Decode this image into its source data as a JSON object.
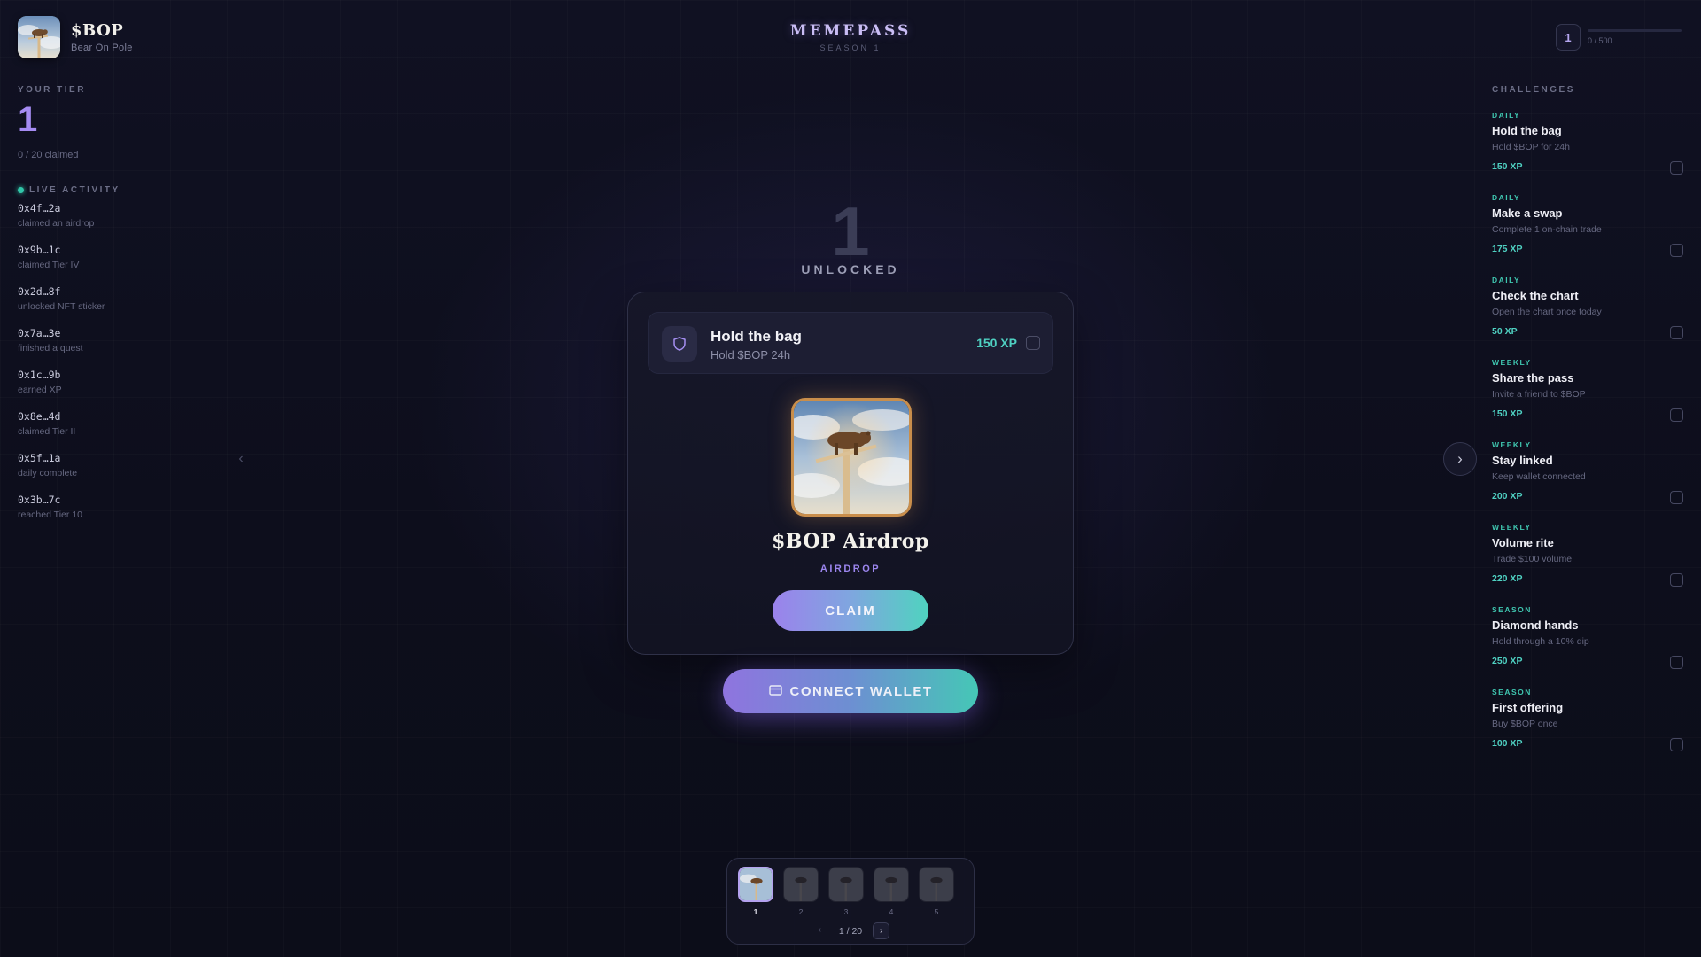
{
  "brand": {
    "name": "$BOP",
    "subtitle": "Bear On Pole",
    "logo_icon": "bear-on-pole-icon"
  },
  "app": {
    "title": "MEMEPASS",
    "season": "SEASON 1"
  },
  "top_tier": {
    "current": "1",
    "progress_text": "0 / 500",
    "progress_fraction": 0
  },
  "left": {
    "tier_label": "YOUR TIER",
    "tier_value": "1",
    "claimed_text": "0 / 20 claimed",
    "live_label": "LIVE ACTIVITY",
    "activity": [
      {
        "address": "0x4f…2a",
        "action": "claimed an airdrop"
      },
      {
        "address": "0x9b…1c",
        "action": "claimed Tier IV"
      },
      {
        "address": "0x2d…8f",
        "action": "unlocked NFT sticker"
      },
      {
        "address": "0x7a…3e",
        "action": "finished a quest"
      },
      {
        "address": "0x1c…9b",
        "action": "earned XP"
      },
      {
        "address": "0x8e…4d",
        "action": "claimed Tier II"
      },
      {
        "address": "0x5f…1a",
        "action": "daily complete"
      },
      {
        "address": "0x3b…7c",
        "action": "reached Tier 10"
      }
    ]
  },
  "center": {
    "tier_number": "1",
    "status": "UNLOCKED",
    "challenge": {
      "title": "Hold the bag",
      "description": "Hold $BOP 24h",
      "xp": "150 XP",
      "icon": "shield-icon"
    },
    "reward": {
      "title": "$BOP Airdrop",
      "type": "AIRDROP"
    },
    "claim_label": "CLAIM",
    "wallet_label": "CONNECT WALLET",
    "wallet_icon": "wallet-icon",
    "nav_prev": "‹",
    "nav_next": "›"
  },
  "thumbnails": {
    "items": [
      {
        "num": "1",
        "active": true
      },
      {
        "num": "2",
        "active": false
      },
      {
        "num": "3",
        "active": false
      },
      {
        "num": "4",
        "active": false
      },
      {
        "num": "5",
        "active": false
      }
    ],
    "page_text": "1 / 20",
    "prev": "‹",
    "next": "›"
  },
  "challenges": {
    "label": "CHALLENGES",
    "items": [
      {
        "category": "DAILY",
        "title": "Hold the bag",
        "desc": "Hold $BOP for 24h",
        "xp": "150 XP"
      },
      {
        "category": "DAILY",
        "title": "Make a swap",
        "desc": "Complete 1 on-chain trade",
        "xp": "175 XP"
      },
      {
        "category": "DAILY",
        "title": "Check the chart",
        "desc": "Open the chart once today",
        "xp": "50 XP"
      },
      {
        "category": "WEEKLY",
        "title": "Share the pass",
        "desc": "Invite a friend to $BOP",
        "xp": "150 XP"
      },
      {
        "category": "WEEKLY",
        "title": "Stay linked",
        "desc": "Keep wallet connected",
        "xp": "200 XP"
      },
      {
        "category": "WEEKLY",
        "title": "Volume rite",
        "desc": "Trade $100 volume",
        "xp": "220 XP"
      },
      {
        "category": "SEASON",
        "title": "Diamond hands",
        "desc": "Hold through a 10% dip",
        "xp": "250 XP"
      },
      {
        "category": "SEASON",
        "title": "First offering",
        "desc": "Buy $BOP once",
        "xp": "100 XP"
      }
    ]
  }
}
